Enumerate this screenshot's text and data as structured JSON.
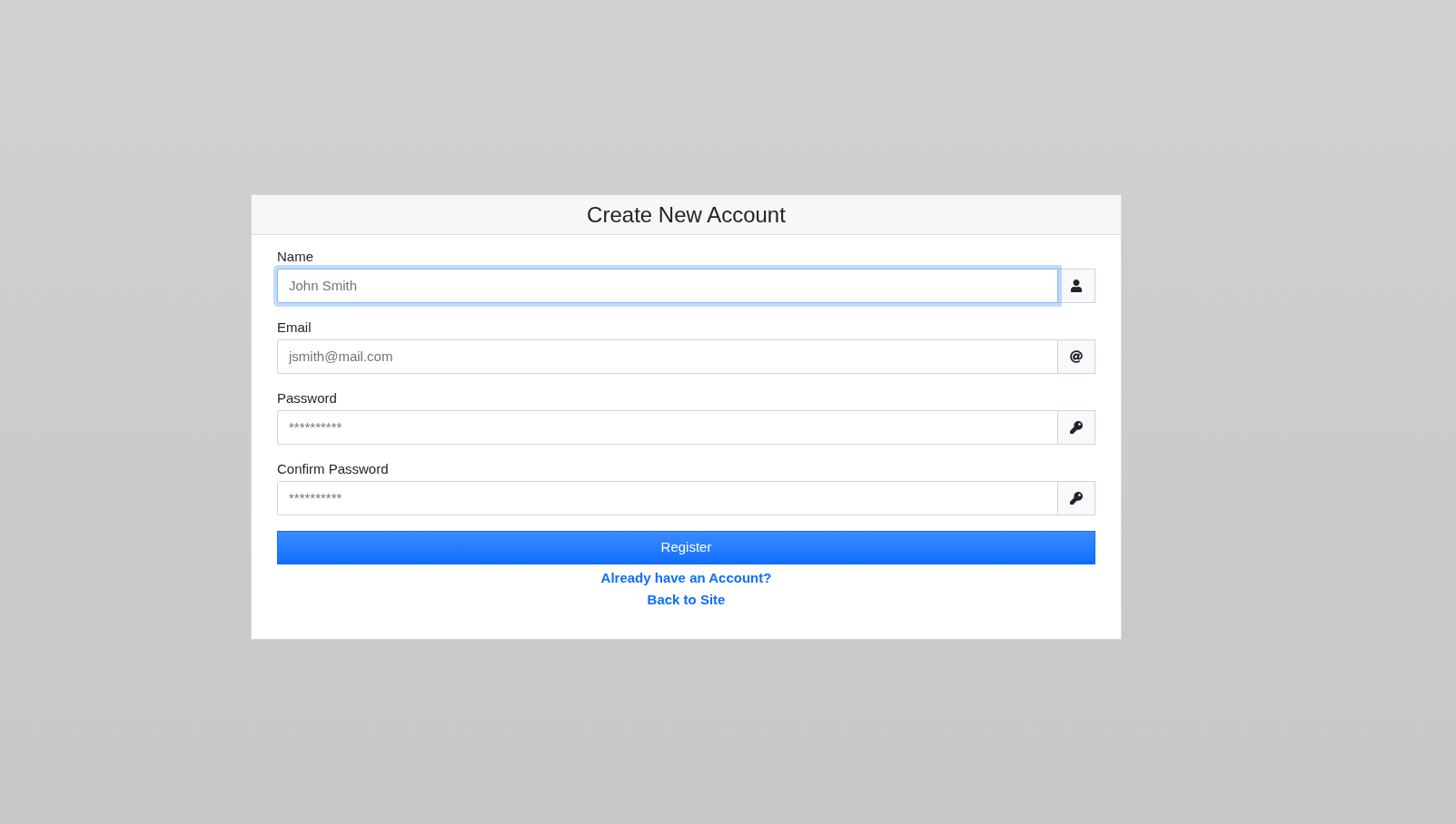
{
  "card": {
    "title": "Create New Account"
  },
  "fields": [
    {
      "label": "Name",
      "placeholder": "John Smith",
      "kind": "name",
      "focused": true
    },
    {
      "label": "Email",
      "placeholder": "jsmith@mail.com",
      "kind": "email",
      "focused": false
    },
    {
      "label": "Password",
      "placeholder": "**********",
      "kind": "password",
      "focused": false
    },
    {
      "label": "Confirm Password",
      "placeholder": "**********",
      "kind": "password",
      "focused": false
    }
  ],
  "register_button": "Register",
  "links": [
    "Already have an Account?",
    "Back to Site"
  ]
}
